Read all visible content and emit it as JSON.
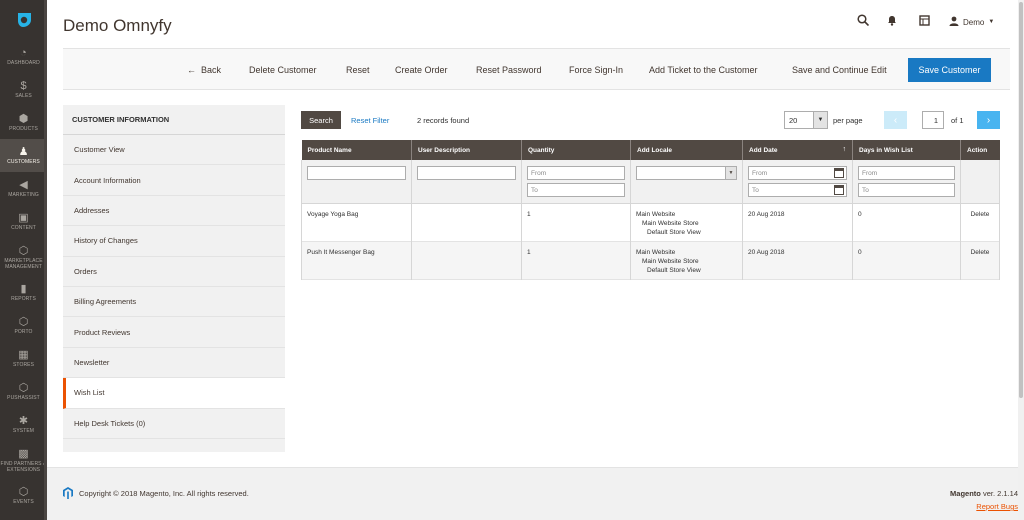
{
  "nav": {
    "items": [
      {
        "label": "DASHBOARD",
        "icon": "speedometer-icon",
        "glyph": "◔"
      },
      {
        "label": "SALES",
        "icon": "dollar-icon",
        "glyph": "$"
      },
      {
        "label": "PRODUCTS",
        "icon": "cube-icon",
        "glyph": "⬢"
      },
      {
        "label": "CUSTOMERS",
        "icon": "person-icon",
        "glyph": "♟",
        "active": true
      },
      {
        "label": "MARKETING",
        "icon": "megaphone-icon",
        "glyph": "◀"
      },
      {
        "label": "CONTENT",
        "icon": "layout-icon",
        "glyph": "▣"
      },
      {
        "label": "MARKETPLACE MANAGEMENT",
        "icon": "hexagon-icon",
        "glyph": "⬡"
      },
      {
        "label": "REPORTS",
        "icon": "bar-chart-icon",
        "glyph": "▮"
      },
      {
        "label": "PORTO",
        "icon": "hexagon-icon",
        "glyph": "⬡"
      },
      {
        "label": "STORES",
        "icon": "store-icon",
        "glyph": "▦"
      },
      {
        "label": "PUSHASSIST",
        "icon": "hexagon-icon",
        "glyph": "⬡"
      },
      {
        "label": "SYSTEM",
        "icon": "gear-icon",
        "glyph": "✱"
      },
      {
        "label": "FIND PARTNERS & EXTENSIONS",
        "icon": "puzzle-icon",
        "glyph": "▩"
      },
      {
        "label": "EVENTS",
        "icon": "hexagon-icon",
        "glyph": "⬡"
      }
    ]
  },
  "header": {
    "title": "Demo Omnyfy",
    "user": "Demo"
  },
  "actions": {
    "back": "Back",
    "delete_customer": "Delete Customer",
    "reset": "Reset",
    "create_order": "Create Order",
    "reset_password": "Reset Password",
    "force_sign_in": "Force Sign-In",
    "add_ticket": "Add Ticket to the Customer",
    "save_continue": "Save and Continue Edit",
    "save_customer": "Save Customer"
  },
  "tabs": {
    "title": "CUSTOMER INFORMATION",
    "items": [
      "Customer View",
      "Account Information",
      "Addresses",
      "History of Changes",
      "Orders",
      "Billing Agreements",
      "Product Reviews",
      "Newsletter",
      "Wish List",
      "Help Desk Tickets (0)"
    ],
    "active_index": 8
  },
  "grid": {
    "search_label": "Search",
    "reset_filter": "Reset Filter",
    "records_found": "2 records found",
    "per_page_value": "20",
    "per_page_label": "per page",
    "page": "1",
    "of_pages": "of 1",
    "columns": [
      "Product Name",
      "User Description",
      "Quantity",
      "Add Locale",
      "Add Date",
      "Days in Wish List",
      "Action"
    ],
    "filter_from": "From",
    "filter_to": "To",
    "rows": [
      {
        "product": "Voyage Yoga Bag",
        "description": "",
        "quantity": "1",
        "locale": [
          "Main Website",
          "Main Website Store",
          "Default Store View"
        ],
        "date": "20 Aug 2018",
        "days": "0",
        "action": "Delete"
      },
      {
        "product": "Push It Messenger Bag",
        "description": "",
        "quantity": "1",
        "locale": [
          "Main Website",
          "Main Website Store",
          "Default Store View"
        ],
        "date": "20 Aug 2018",
        "days": "0",
        "action": "Delete"
      }
    ]
  },
  "footer": {
    "copyright": "Copyright © 2018 Magento, Inc. All rights reserved.",
    "version_brand": "Magento",
    "version_text": " ver. 2.1.14",
    "report_bugs": "Report Bugs"
  },
  "colors": {
    "accent": "#eb5202",
    "primary_button": "#1979c3",
    "nav_bg": "#373330",
    "grid_header": "#514943"
  }
}
